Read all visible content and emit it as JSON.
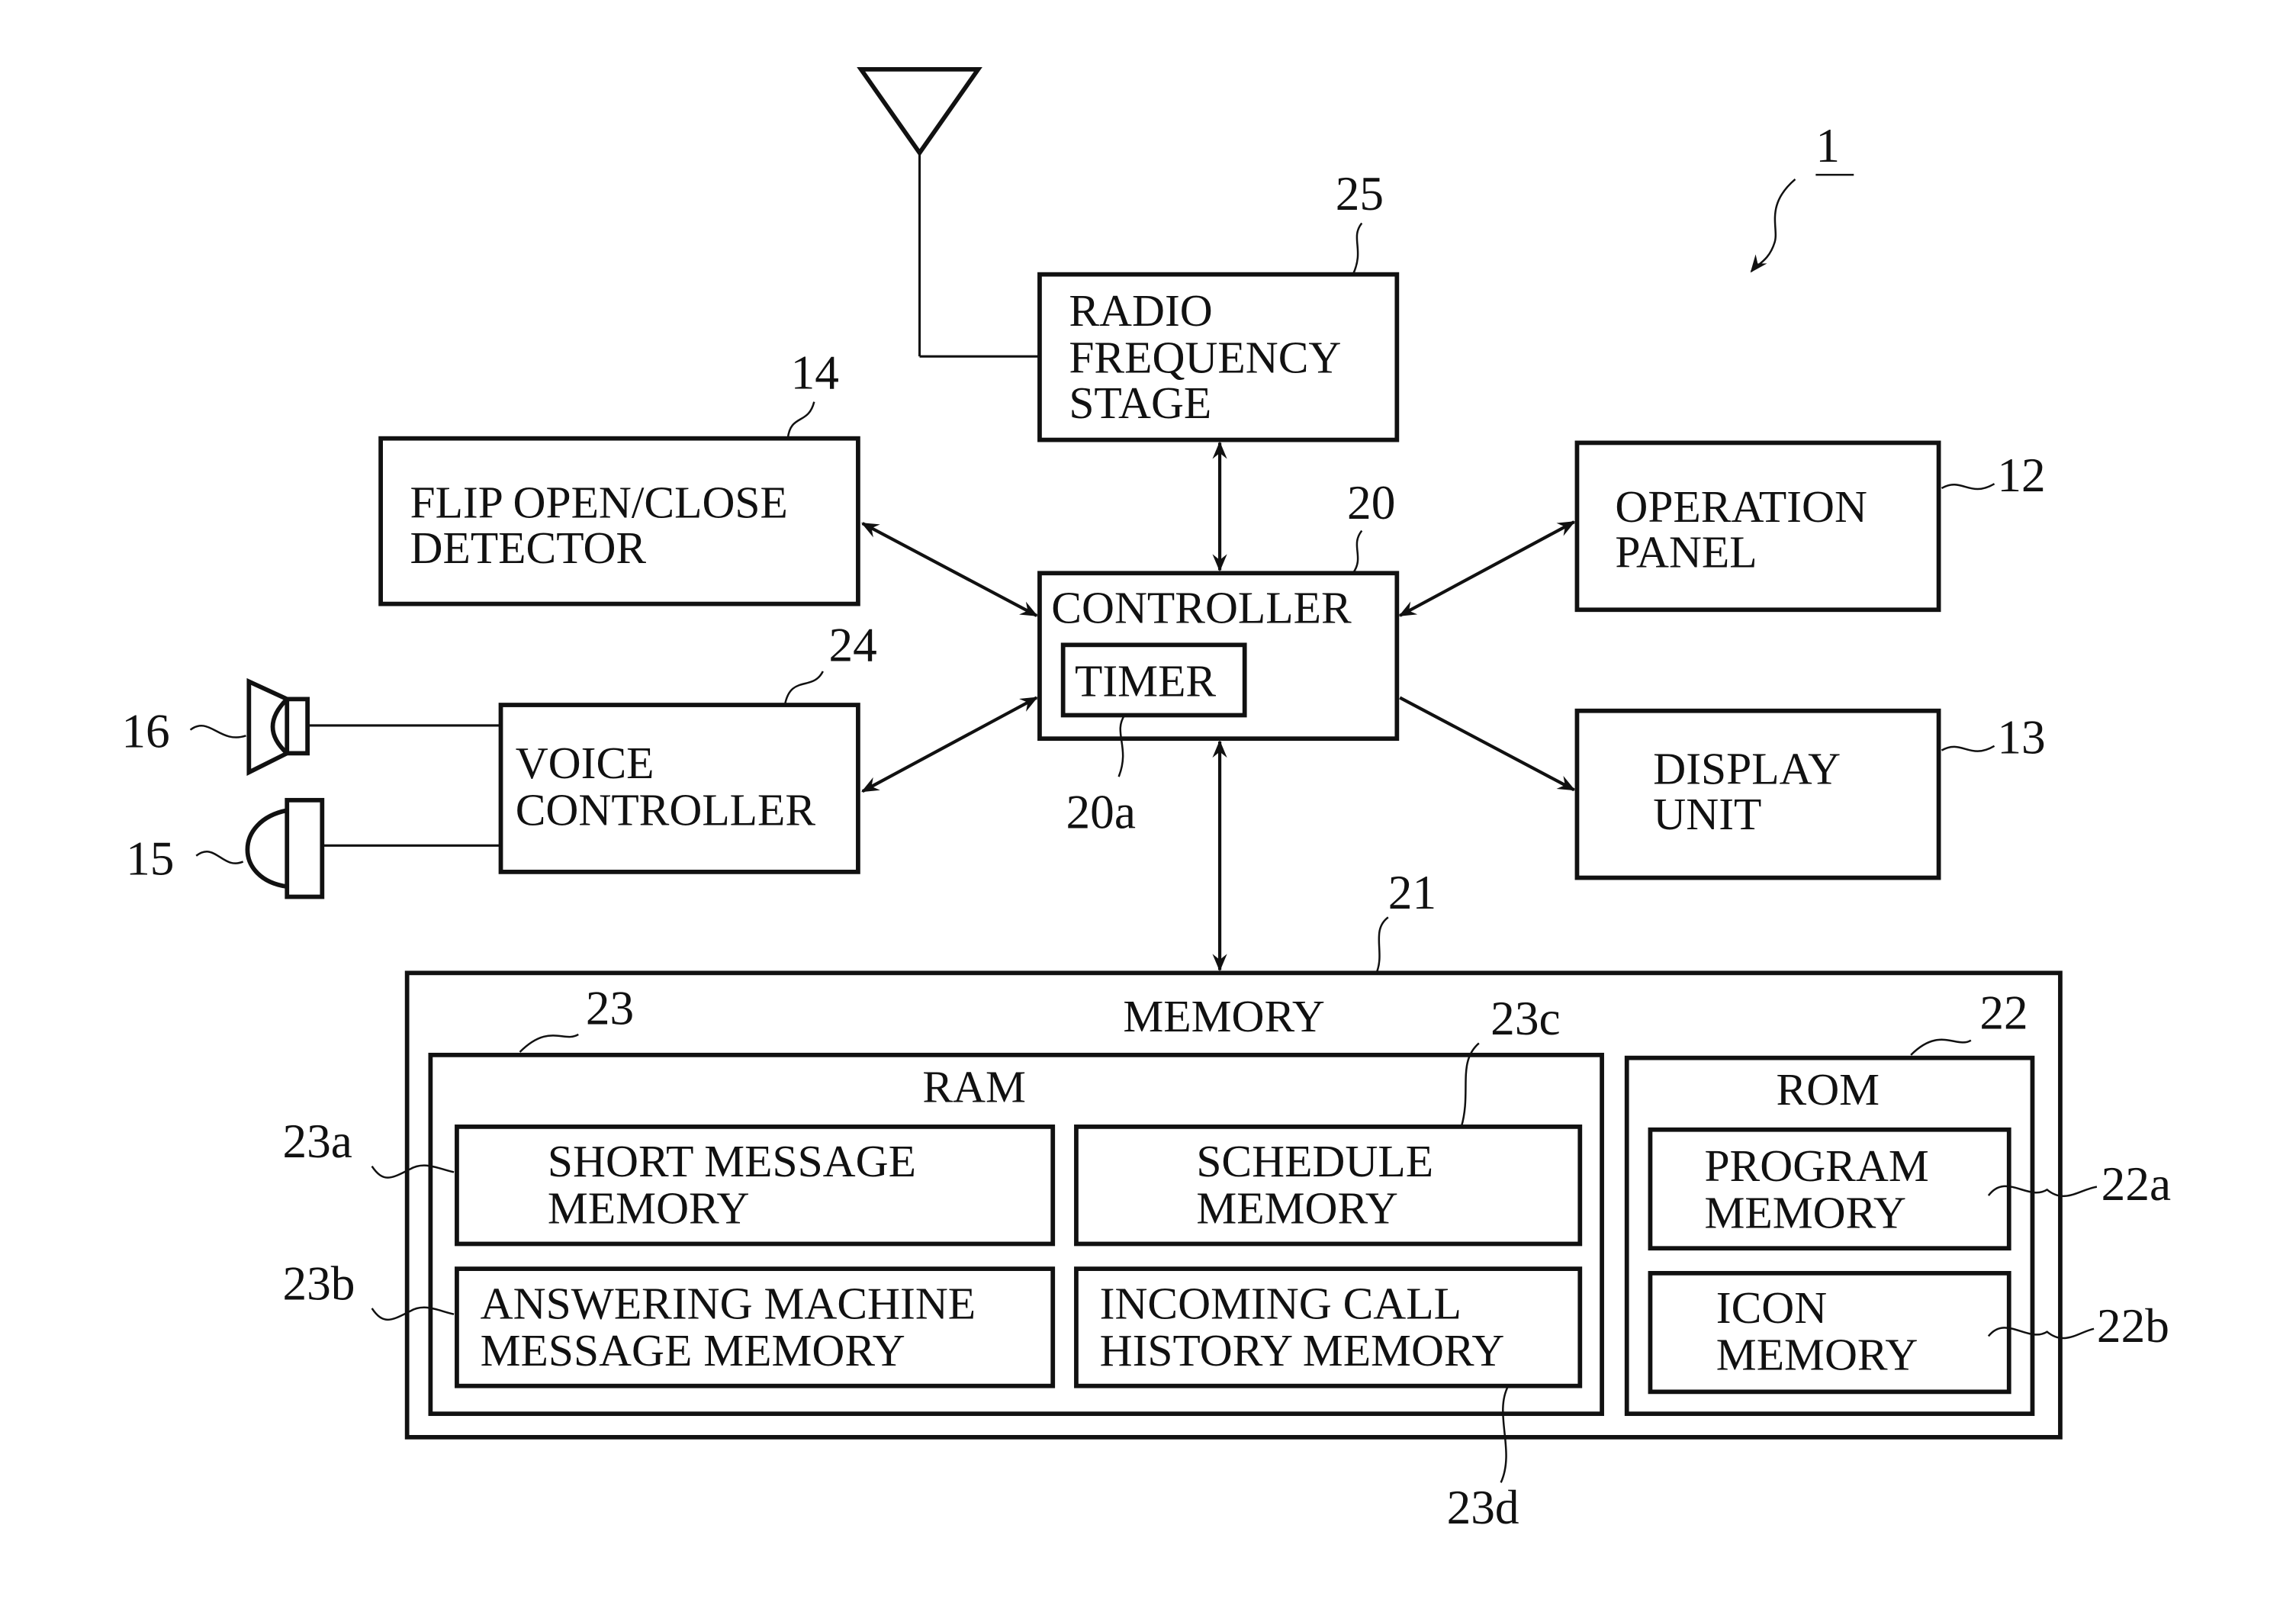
{
  "figure": {
    "ref": "1",
    "blocks": {
      "radio": {
        "ref": "25",
        "lines": [
          "RADIO",
          "FREQUENCY",
          "STAGE"
        ]
      },
      "flip": {
        "ref": "14",
        "lines": [
          "FLIP OPEN/CLOSE",
          "DETECTOR"
        ]
      },
      "controller": {
        "ref": "20",
        "lines": [
          "CONTROLLER"
        ]
      },
      "timer": {
        "ref": "20a",
        "lines": [
          "TIMER"
        ]
      },
      "operation": {
        "ref": "12",
        "lines": [
          "OPERATION",
          "PANEL"
        ]
      },
      "display": {
        "ref": "13",
        "lines": [
          "DISPLAY",
          "UNIT"
        ]
      },
      "voice": {
        "ref": "24",
        "lines": [
          "VOICE",
          "CONTROLLER"
        ]
      },
      "speaker": {
        "ref": "16"
      },
      "microphone": {
        "ref": "15"
      },
      "memory": {
        "ref": "21",
        "lines": [
          "MEMORY"
        ]
      },
      "ram": {
        "ref": "23",
        "lines": [
          "RAM"
        ]
      },
      "rom": {
        "ref": "22",
        "lines": [
          "ROM"
        ]
      },
      "short_message": {
        "ref": "23a",
        "lines": [
          "SHORT MESSAGE",
          "MEMORY"
        ]
      },
      "answering": {
        "ref": "23b",
        "lines": [
          "ANSWERING MACHINE",
          "MESSAGE MEMORY"
        ]
      },
      "schedule": {
        "ref": "23c",
        "lines": [
          "SCHEDULE",
          "MEMORY"
        ]
      },
      "incoming": {
        "ref": "23d",
        "lines": [
          "INCOMING CALL",
          "HISTORY MEMORY"
        ]
      },
      "program": {
        "ref": "22a",
        "lines": [
          "PROGRAM",
          "MEMORY"
        ]
      },
      "icon": {
        "ref": "22b",
        "lines": [
          "ICON",
          "MEMORY"
        ]
      }
    }
  }
}
